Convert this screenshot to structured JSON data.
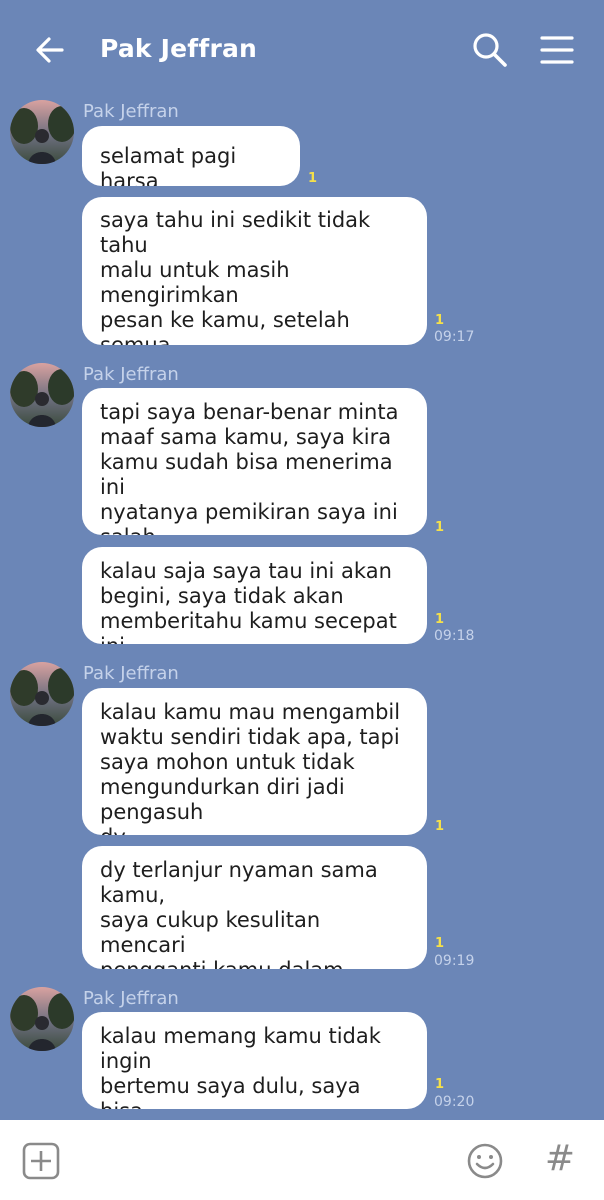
{
  "header": {
    "title": "Pak Jeffran",
    "back_icon": "arrow-left-icon",
    "search_icon": "search-icon",
    "menu_icon": "hamburger-menu-icon"
  },
  "colors": {
    "background": "#6b86b7",
    "bubble": "#ffffff",
    "read_indicator": "#f5e04a",
    "meta_text": "#c5d2ea"
  },
  "messages": [
    {
      "sender": "Pak Jeffran",
      "text": "selamat pagi harsa",
      "read": "1",
      "time": ""
    },
    {
      "text": "saya tahu ini sedikit tidak tahu\nmalu untuk masih mengirimkan\npesan ke kamu, setelah semua\nyang udah saya ungkapin\nsemalam",
      "read": "1",
      "time": "09:17"
    },
    {
      "sender": "Pak Jeffran",
      "text": "tapi saya benar-benar minta\nmaaf sama kamu, saya kira\nkamu sudah bisa menerima ini\nnyatanya pemikiran saya ini\nsalah",
      "read": "1",
      "time": ""
    },
    {
      "text": "kalau saja saya tau ini akan\nbegini, saya tidak akan\nmemberitahu kamu secepat ini",
      "read": "1",
      "time": "09:18"
    },
    {
      "sender": "Pak Jeffran",
      "text": "kalau kamu mau mengambil\nwaktu sendiri tidak apa, tapi\nsaya mohon untuk tidak\nmengundurkan diri jadi pengasuh\ndy",
      "read": "1",
      "time": ""
    },
    {
      "text": "dy terlanjur nyaman sama kamu,\nsaya cukup kesulitan mencari\npengganti kamu dalam waktu\ncepat ini",
      "read": "1",
      "time": "09:19"
    },
    {
      "sender": "Pak Jeffran",
      "text": "kalau memang kamu tidak ingin\nbertemu saya dulu, saya bisa\npaham harsa",
      "read": "1",
      "time": "09:20"
    }
  ],
  "footer": {
    "plus_icon": "add-box-icon",
    "emoji_icon": "smiley-icon",
    "hash_icon": "hashtag-icon",
    "hash_glyph": "#"
  }
}
